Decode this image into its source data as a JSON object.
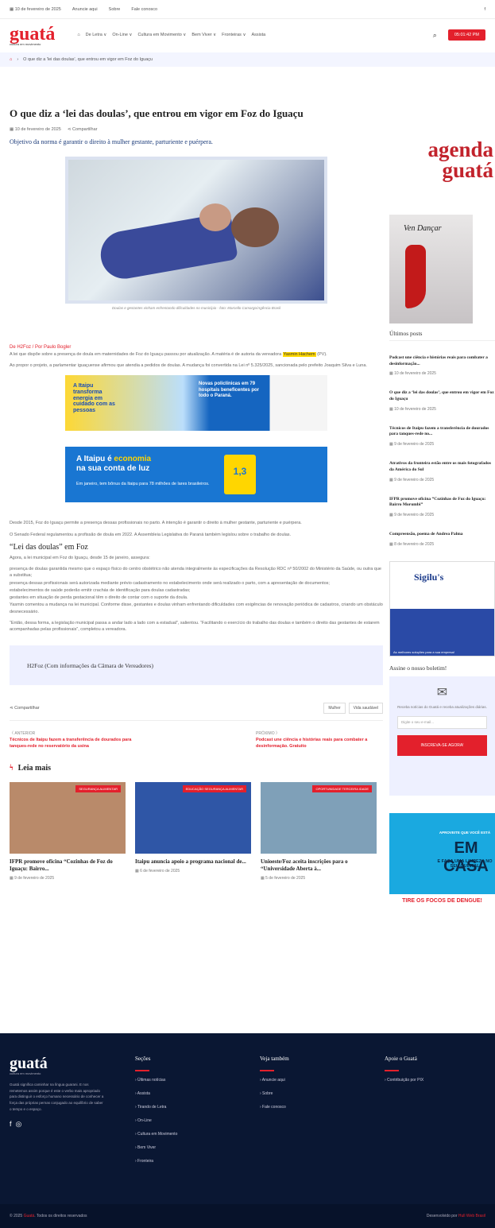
{
  "topbar": {
    "date": "10 de fevereiro de 2025",
    "links": [
      "Anuncie aqui",
      "Sobre",
      "Fale conosco"
    ],
    "social": "f"
  },
  "header": {
    "logo": "guatá",
    "tagline": "cultura em movimento",
    "nav": [
      "De Letra ∨",
      "On-Line ∨",
      "Cultura em Movimento ∨",
      "Bem Viver ∨",
      "Fronteiras ∨",
      "Assista"
    ],
    "clock": "05:01:42 PM"
  },
  "breadcrumb": "O que diz a 'lei das doulas', que entrou em vigor em Foz do Iguaçu",
  "article": {
    "title": "O que diz a ‘lei das doulas’, que entrou em vigor em Foz do Iguaçu",
    "date": "10 de fevereiro de 2025",
    "share": "Compartilhar",
    "lead": "Objetivo da norma é garantir o direito à mulher gestante, parturiente e puérpera.",
    "caption": "Doulas e gestantes vinham enfrentando dificuldades no município - foto: Marcello Camargo/Agência Brasil",
    "author": "De H2Foz / Por Paulo Bogler",
    "p1a": "A lei que dispõe sobre a presença de doula em maternidades de Foz do Iguaçu passou por atualização. A matéria é de autoria da vereadora ",
    "p1b": "Yasmin Hachem",
    "p1c": " (PV).",
    "p2": "Ao propor o projeto, a parlamentar iguaçuense afirmou que atendia a pedidos de doulas. A mudança foi convertida na Lei nº 5.325/2025, sancionada pelo prefeito Joaquim Silva e Luna.",
    "banner1_left": "A Itaipu transforma energia em cuidado com as pessoas",
    "banner1_mid": "Novas policlínicas em 79 hospitais beneficentes por todo o Paraná.",
    "banner2_title_a": "A Itaipu é",
    "banner2_title_b": "economia",
    "banner2_title_c": "na sua conta de luz",
    "banner2_sub": "Em janeiro, tem bônus da Itaipu para 78 milhões de lares brasileiros.",
    "banner2_bill": "1,3",
    "p3": "Desde 2015, Foz do Iguaçu permite a presença dessas profissionais no parto. A intenção é garantir o direito à mulher gestante, parturiente e puérpera.",
    "p4": "O Senado Federal regulamentou a profissão de doula em 2022. A Assembleia Legislativa do Paraná também legislou sobre o trabalho de doulas.",
    "h2": "“Lei das doulas” em Foz",
    "p5": "Agora, a lei municipal em Foz do Iguaçu, desde 15 de janeiro, assegura:",
    "p6": "presença de doulas garantida mesmo que o espaço físico do centro obstétrico não atenda integralmente às especificações da Resolução RDC nº 50/2002 do Ministério da Saúde, ou outra que a substitua;",
    "p7": "presença dessas profissionais será autorizada mediante prévio cadastramento no estabelecimento onde será realizado o parto, com a apresentação de documentos;",
    "p8": "estabelecimentos de saúde poderão emitir crachás de identificação para doulas cadastradas;",
    "p9": "gestantes em situação de perda gestacional têm o direito de contar com o suporte da doula.",
    "p10": "Yasmin comentou a mudança na lei municipal. Conforme disse, gestantes e doulas vinham enfrentando dificuldades com exigências de renovação periódica de cadastros, criando um obstáculo desnecessário.",
    "p11": "“Então, dessa forma, a legislação municipal passa a andar lado a lado com a estadual”, salientou. “Facilitando o exercício do trabalho das doulas e também o direito das gestantes de estarem acompanhadas pelas profissionais”, completou a vereadora.",
    "quote": "H2Foz (Com informações da Câmara de Vereadores)",
    "tags": [
      "Mulher",
      "Vida saudável"
    ],
    "prev_label": "〈 ANTERIOR",
    "prev_title": "Técnicos de Itaipu fazem a transferência de dourados para tanques-rede no reservatório da usina",
    "next_label": "PRÓXIMO 〉",
    "next_title": "Podcast une ciência e histórias reais para combater a desinformação. Gratuito"
  },
  "leia_mais": {
    "title": "Leia mais",
    "cards": [
      {
        "badge": "SEGURANÇA ALIMENTAR",
        "title": "IFPR promove oficina “Cozinhas de Foz do Iguaçu: Bairro...",
        "date": "9 de fevereiro de 2025",
        "color": "#b98a6a"
      },
      {
        "badge": "EDUCAÇÃO SEGURANÇA ALIMENTAR",
        "title": "Itaipu anuncia apoio a programa nacional de...",
        "date": "6 de fevereiro de 2025",
        "color": "#2f56a6"
      },
      {
        "badge": "OPORTUNIDADE TERCEIRA IDADE",
        "title": "Unioeste/Foz aceita inscrições para o “Universidade Aberta à...",
        "date": "5 de fevereiro de 2025",
        "color": "#7fa0b8"
      }
    ]
  },
  "sidebar": {
    "agenda_a": "agenda",
    "agenda_b": "guatá",
    "poster": "Ven Dançar",
    "ultimos": "Últimos posts",
    "posts": [
      {
        "t": "Podcast une ciência e histórias reais para combater a desinformação...",
        "d": "10 de fevereiro de 2025"
      },
      {
        "t": "O que diz a ‘lei das doulas’, que entrou em vigor em Foz do Iguaçu",
        "d": "10 de fevereiro de 2025"
      },
      {
        "t": "Técnicos de Itaipu fazem a transferência de dourados para tanques-rede no...",
        "d": "9 de fevereiro de 2025"
      },
      {
        "t": "Atrativos da fronteira estão entre os mais fotografados da América do Sul",
        "d": "9 de fevereiro de 2025"
      },
      {
        "t": "IFPR promove oficina “Cozinhas de Foz do Iguaçu: Bairro Morumbi”",
        "d": "9 de fevereiro de 2025"
      },
      {
        "t": "Compreensão, poema de Andrea Palma",
        "d": "8 de fevereiro de 2025"
      }
    ],
    "sigilus": "Sigilu's",
    "sigilus_foot": "As melhores soluções para a sua empresa!",
    "news_h": "Assine o nosso boletim!",
    "news_text": "Receba notícias do Guatá e receba atualizações diárias.",
    "news_ph": "Digite o seu e-mail...",
    "news_btn": "INSCREVA-SE AGORA!",
    "dengue_1": "APROVEITE QUE VOCÊ ESTÁ",
    "dengue_2": "EM CASA",
    "dengue_3": "E FAÇA UMA LIMPEZA NO SEU QUINTAL",
    "dengue_4": "TIRE OS FOCOS DE DENGUE!"
  },
  "footer": {
    "logo": "guatá",
    "tagline": "cultura em movimento",
    "desc": "Guatá significa caminhar na língua guarani. E nos remetemos assim porque é este o verbo mais apropriado para distinguir o esforço humano necessário de conhecer a força das próprias pernas conjugado ao equilíbrio de saber o tempo e o espaço.",
    "col1_h": "Seções",
    "col1": [
      "› Últimas notícias",
      "› Assista",
      "› Tirando de Letra",
      "› On-Line",
      "› Cultura em Movimento",
      "› Bem Viver",
      "› Fronteira"
    ],
    "col2_h": "Veja também",
    "col2": [
      "› Anuncie aqui",
      "› Sobre",
      "› Fale conosco"
    ],
    "col3_h": "Apoie o Guatá",
    "col3": [
      "› Contribuição por PIX"
    ],
    "copy_a": "© 2025 ",
    "copy_b": "Guatá",
    "copy_c": ". Todos os direitos reservados",
    "dev_a": "Desenvolvido por ",
    "dev_b": "Hull Web Brasil"
  }
}
